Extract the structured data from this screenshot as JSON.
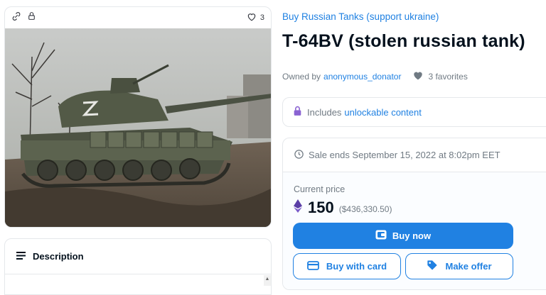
{
  "left_card": {
    "favorite_count": "3"
  },
  "description": {
    "heading": "Description"
  },
  "item": {
    "collection": "Buy Russian Tanks (support ukraine)",
    "title": "T-64BV (stolen russian tank)",
    "owned_by_label": "Owned by",
    "owner": "anonymous_donator",
    "favorites": "3 favorites"
  },
  "unlockable": {
    "prefix": "Includes",
    "link": "unlockable content"
  },
  "sale": {
    "ends": "Sale ends September 15, 2022 at 8:02pm EET",
    "current_price_label": "Current price",
    "price": "150",
    "price_usd": "($436,330.50)",
    "buy_now": "Buy now",
    "buy_with_card": "Buy with card",
    "make_offer": "Make offer"
  },
  "colors": {
    "accent": "#2081e2",
    "text": "#04111d",
    "muted": "#707a83",
    "unlock_icon": "#8a63d2"
  }
}
